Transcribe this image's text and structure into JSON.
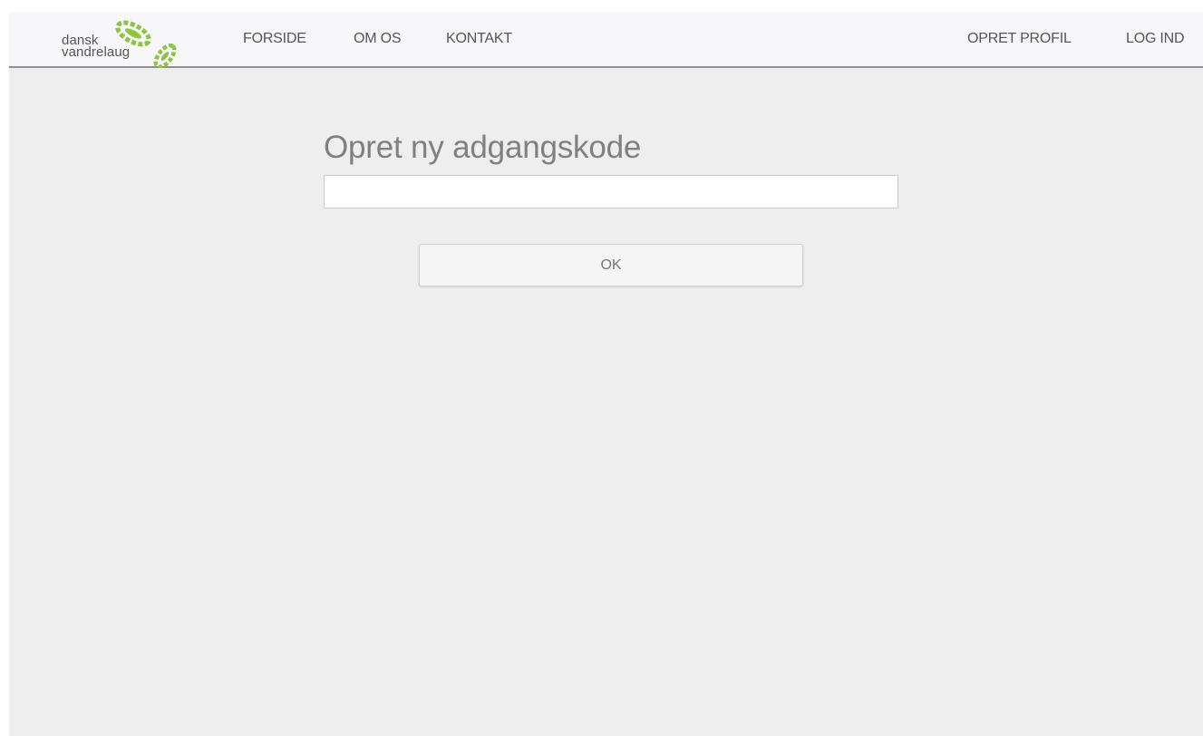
{
  "header": {
    "logo": {
      "line1": "dansk",
      "line2": "vandrelaug",
      "accent_color": "#8cc63f"
    },
    "nav_left": [
      {
        "label": "FORSIDE"
      },
      {
        "label": "OM OS"
      },
      {
        "label": "KONTAKT"
      }
    ],
    "nav_right": [
      {
        "label": "OPRET PROFIL"
      },
      {
        "label": "LOG IND"
      }
    ]
  },
  "main": {
    "title": "Opret ny adgangskode",
    "password_field": {
      "value": "",
      "placeholder": ""
    },
    "ok_button_label": "OK"
  },
  "colors": {
    "page_background": "#eeeeee",
    "navbar_background": "#f7f7f9",
    "navbar_border": "#8f8f8f",
    "title_color": "#808080"
  }
}
